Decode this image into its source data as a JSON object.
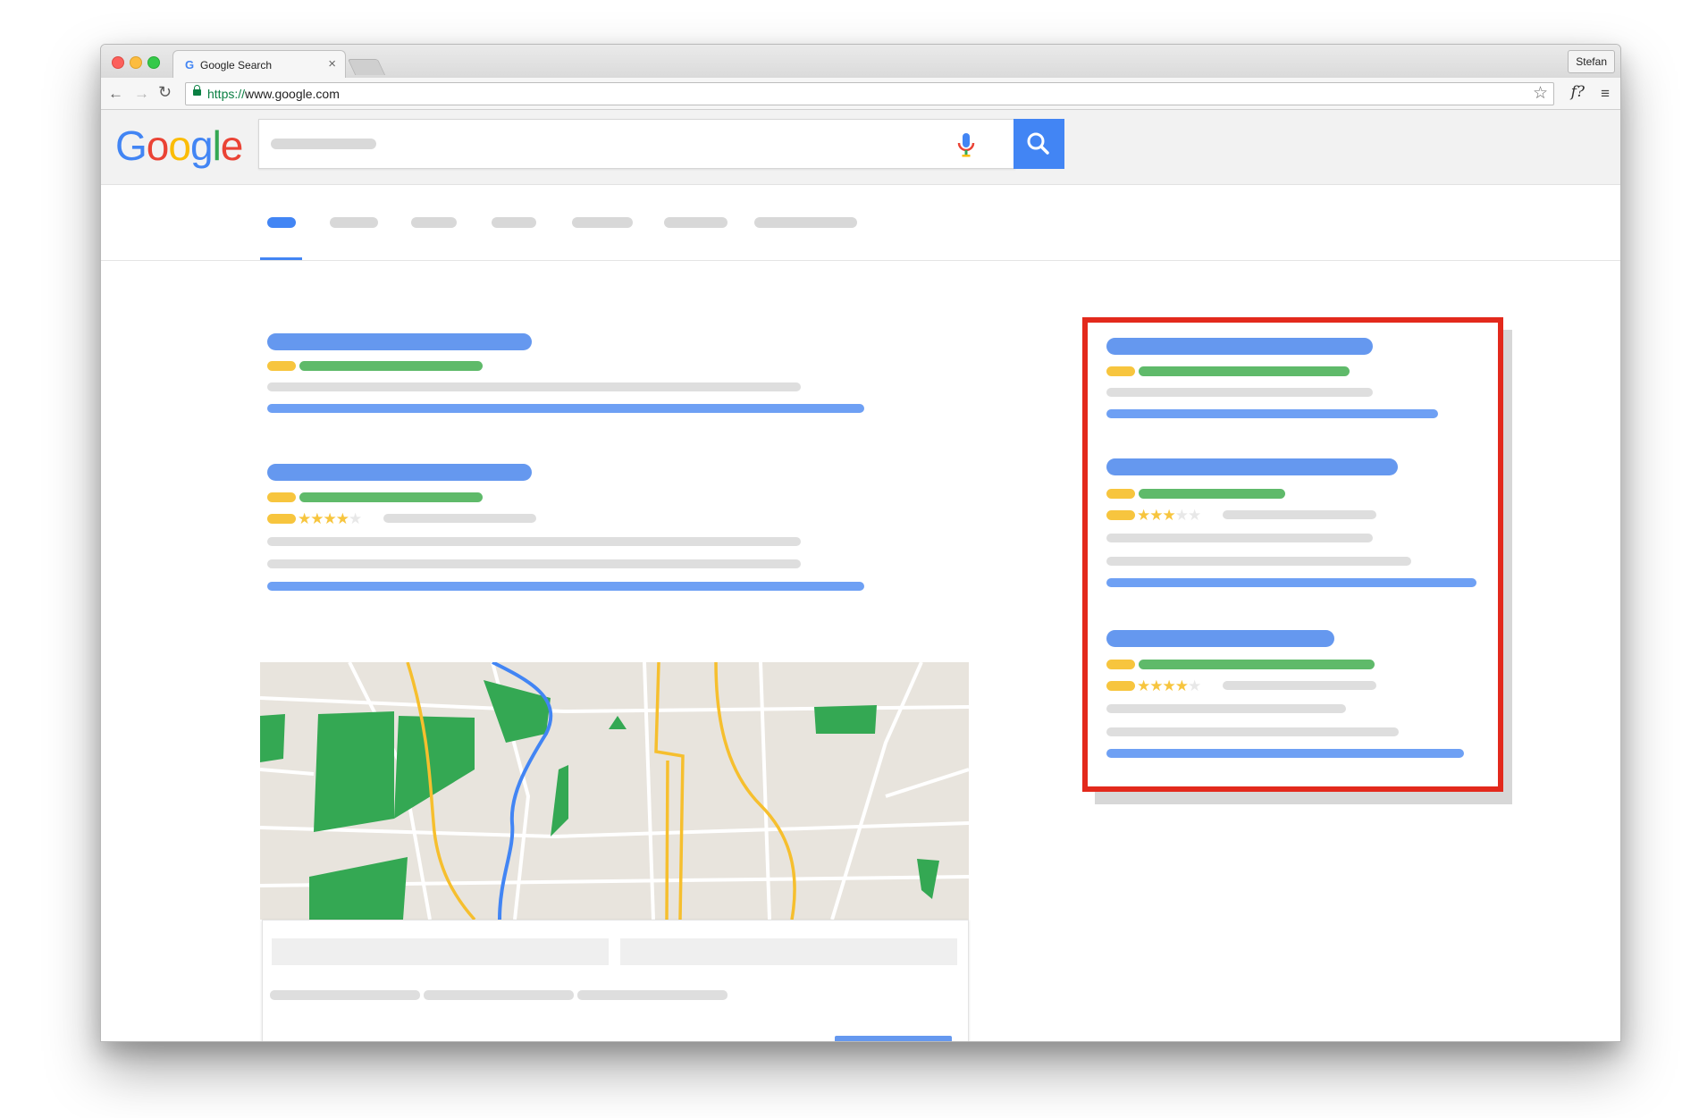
{
  "browser": {
    "tab_title": "Google Search",
    "tab_favicon": "G",
    "tab_close": "×",
    "profile_name": "Stefan",
    "url_scheme": "https://",
    "url_host": "www.google.com",
    "icons": {
      "back": "arrow-left-icon",
      "forward": "arrow-right-icon",
      "reload": "reload-icon",
      "lock": "lock-icon",
      "bookmark": "star-icon",
      "extension": "function-icon",
      "menu": "hamburger-menu-icon"
    },
    "toolbar_glyphs": {
      "back": "←",
      "forward": "→",
      "reload": "↻",
      "bookmark": "☆",
      "extension": "f?",
      "menu": "≡"
    }
  },
  "google": {
    "logo_letters": [
      "G",
      "o",
      "o",
      "g",
      "l",
      "e"
    ],
    "logo_colors": [
      "#4285f4",
      "#ea4335",
      "#fbbc05",
      "#4285f4",
      "#34a853",
      "#ea4335"
    ],
    "search_button_color": "#4285f4"
  },
  "colors": {
    "highlight_border": "#e3291c",
    "title_bar": "#6598ef",
    "url_bar": "#5fba6a",
    "rating_bar": "#f7c53e",
    "text_bar": "#dedede",
    "map_park": "#34a853",
    "map_road_yellow": "#f6bf2e",
    "map_river": "#4285f4",
    "map_land": "#e8e4dd"
  },
  "results": {
    "result_2_rating": 4,
    "result_2_rating_max": 5
  },
  "side_panel": {
    "result_2_rating": 3,
    "result_3_rating": 4,
    "rating_max": 5
  }
}
